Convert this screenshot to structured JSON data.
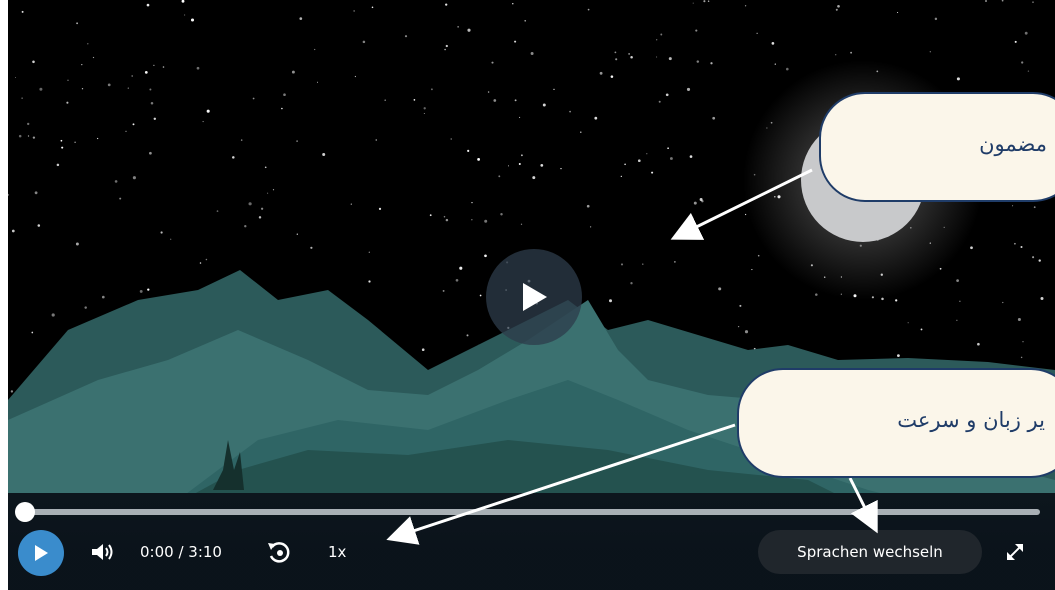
{
  "player": {
    "time": "0:00 / 3:10",
    "speed": "1x",
    "language_button": "Sprachen wechseln",
    "progress": 0,
    "accent_color": "#3a8ccc"
  },
  "icons": {
    "big_play": "play-icon",
    "play": "play-icon",
    "volume": "volume-icon",
    "replay": "replay-10-icon",
    "fullscreen": "fullscreen-icon"
  },
  "annotations": {
    "callout_top": "مضمون",
    "callout_bottom": "یر زبان و سرعت"
  }
}
